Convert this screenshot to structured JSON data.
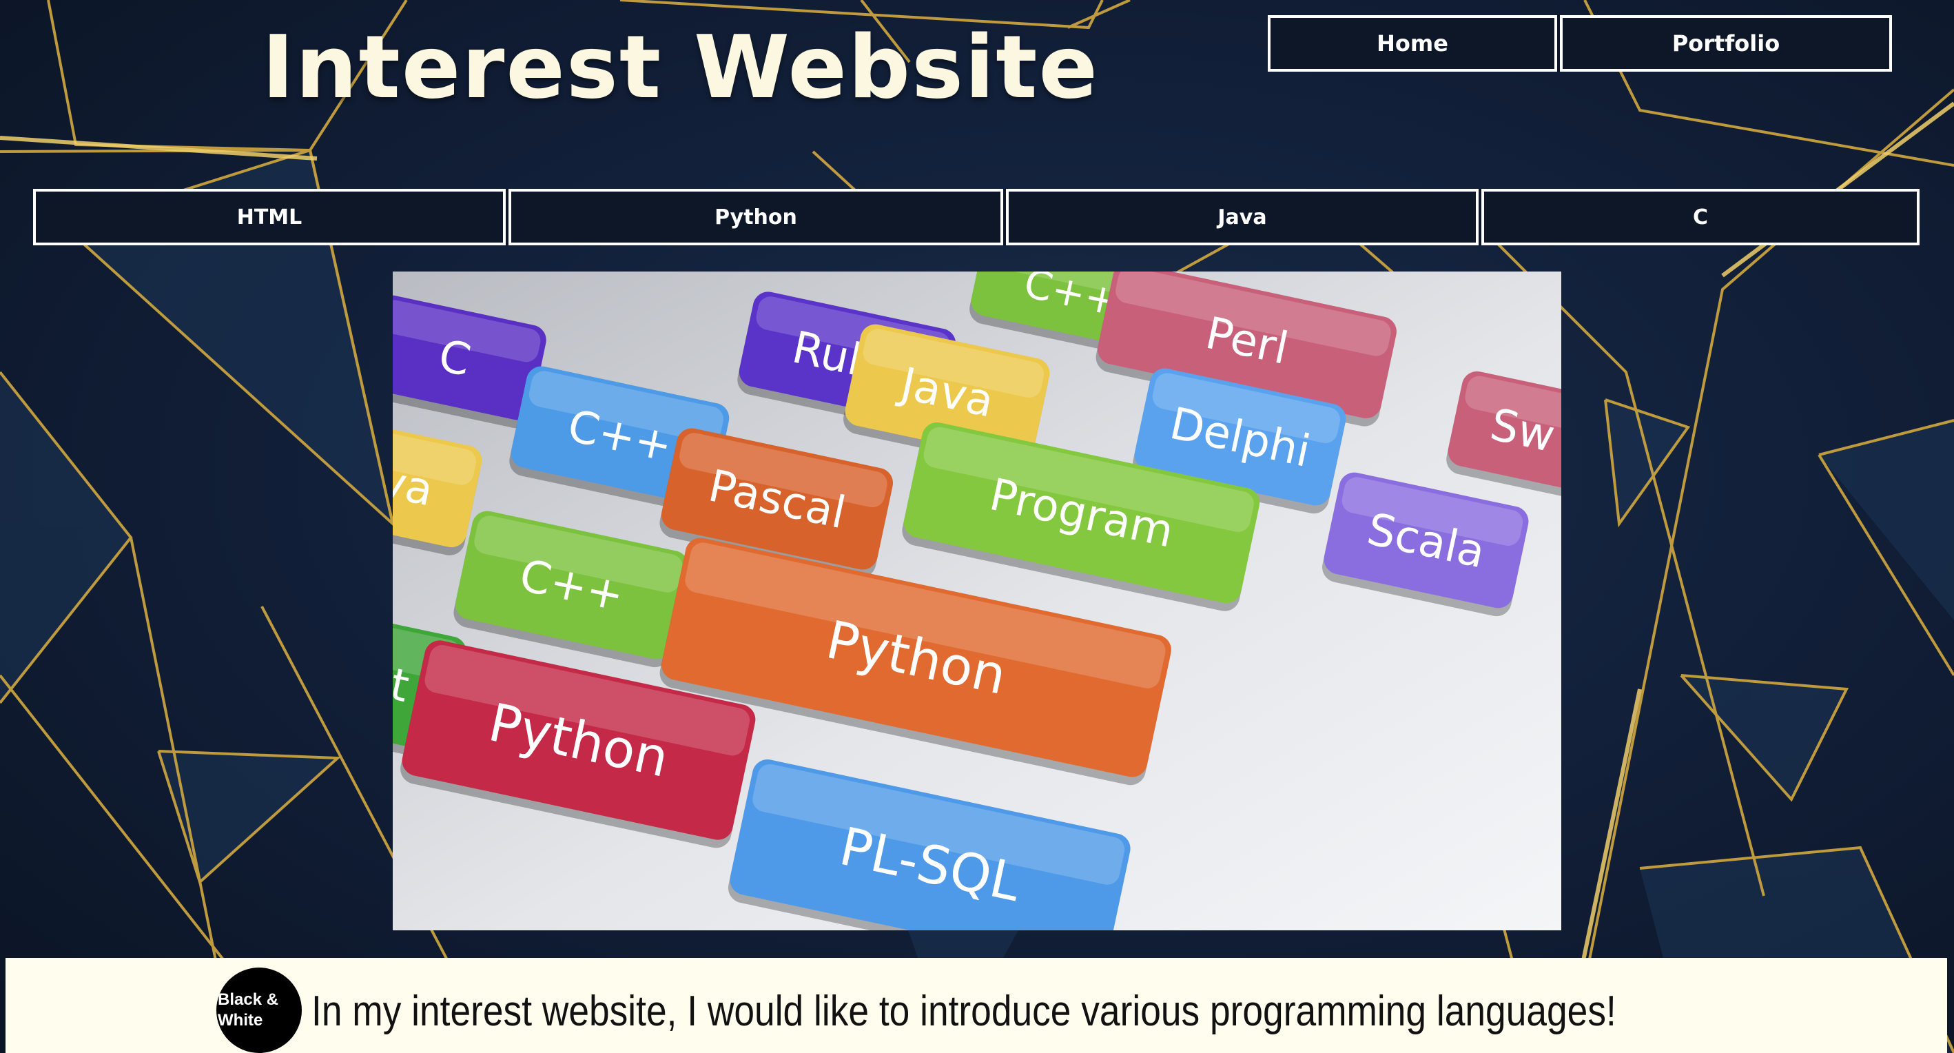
{
  "header": {
    "title": "Interest Website"
  },
  "top_nav": {
    "items": [
      {
        "label": "Home"
      },
      {
        "label": "Portfolio"
      }
    ]
  },
  "language_nav": {
    "items": [
      {
        "label": "HTML"
      },
      {
        "label": "Python"
      },
      {
        "label": "Java"
      },
      {
        "label": "C"
      }
    ]
  },
  "hero_image": {
    "keys": [
      {
        "label": "C++",
        "color": "#7cc23e"
      },
      {
        "label": "Ruby",
        "color": "#5a34c9"
      },
      {
        "label": "Perl",
        "color": "#c9607a"
      },
      {
        "label": "C",
        "color": "#5a2fc4"
      },
      {
        "label": "C++",
        "color": "#4d9ae6"
      },
      {
        "label": "Java",
        "color": "#ecc94c"
      },
      {
        "label": "Delphi",
        "color": "#5aa2ee"
      },
      {
        "label": "Sw",
        "color": "#c9607a"
      },
      {
        "label": "va",
        "color": "#ecc94c"
      },
      {
        "label": "Pascal",
        "color": "#d8622c"
      },
      {
        "label": "Program",
        "color": "#84c83f"
      },
      {
        "label": "Scala",
        "color": "#8a6ee0"
      },
      {
        "label": "C++",
        "color": "#7cc23e"
      },
      {
        "label": "Python",
        "color": "#e06a30"
      },
      {
        "label": "t",
        "color": "#3fa63a"
      },
      {
        "label": "Python",
        "color": "#c42a47"
      },
      {
        "label": "PL-SQL",
        "color": "#4f9ae8"
      }
    ]
  },
  "content": {
    "logo_line1": "Black &",
    "logo_line2": "White",
    "intro": "In my interest website, I would like to introduce various programming languages!"
  },
  "colors": {
    "background": "#12203a",
    "gold_lines": "#d9b24a",
    "title": "#fbf7e0",
    "panel": "#fefdee"
  }
}
